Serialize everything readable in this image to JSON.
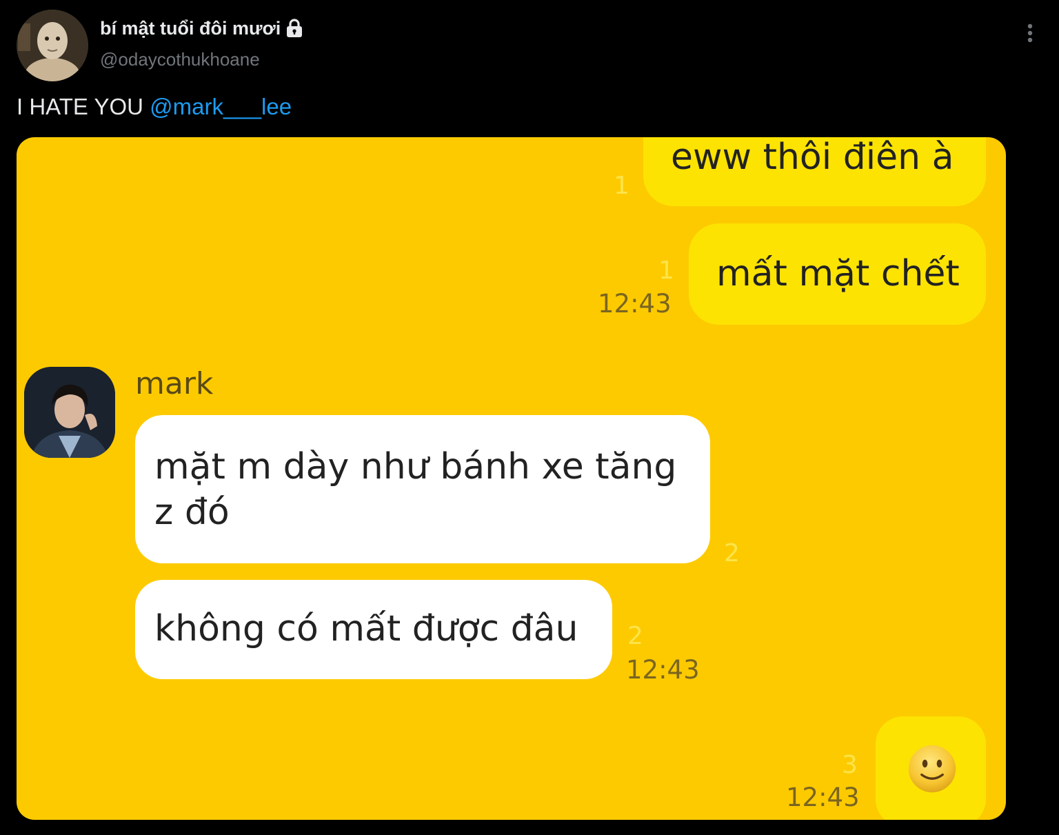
{
  "tweet": {
    "display_name": "bí mật tuổi đôi mươi",
    "handle": "@odaycothukhoane",
    "text": "I HATE YOU ",
    "mention": "@mark___lee"
  },
  "icons": {
    "lock": "lock-icon",
    "more": "more-vertical-icon",
    "emoji": "slightly-smiling-face-icon"
  },
  "colors": {
    "background": "#000000",
    "mention": "#1d9bf0",
    "chat_background": "#fdca00",
    "my_bubble": "#fde302",
    "their_bubble": "#ffffff"
  },
  "chat": {
    "messages": [
      {
        "id": "m1",
        "text": "eww thôi điên à",
        "read": "1"
      },
      {
        "id": "m2",
        "text": "mất mặt chết",
        "read": "1",
        "time": "12:43"
      },
      {
        "id": "m3",
        "text": "mặt m dày như bánh xe tăng z đó",
        "read": "2"
      },
      {
        "id": "m4",
        "text": "không có mất được đâu",
        "read": "2",
        "time": "12:43"
      },
      {
        "id": "m5",
        "text": "🙂",
        "read": "3",
        "time": "12:43"
      }
    ],
    "sender_name": "mark"
  }
}
